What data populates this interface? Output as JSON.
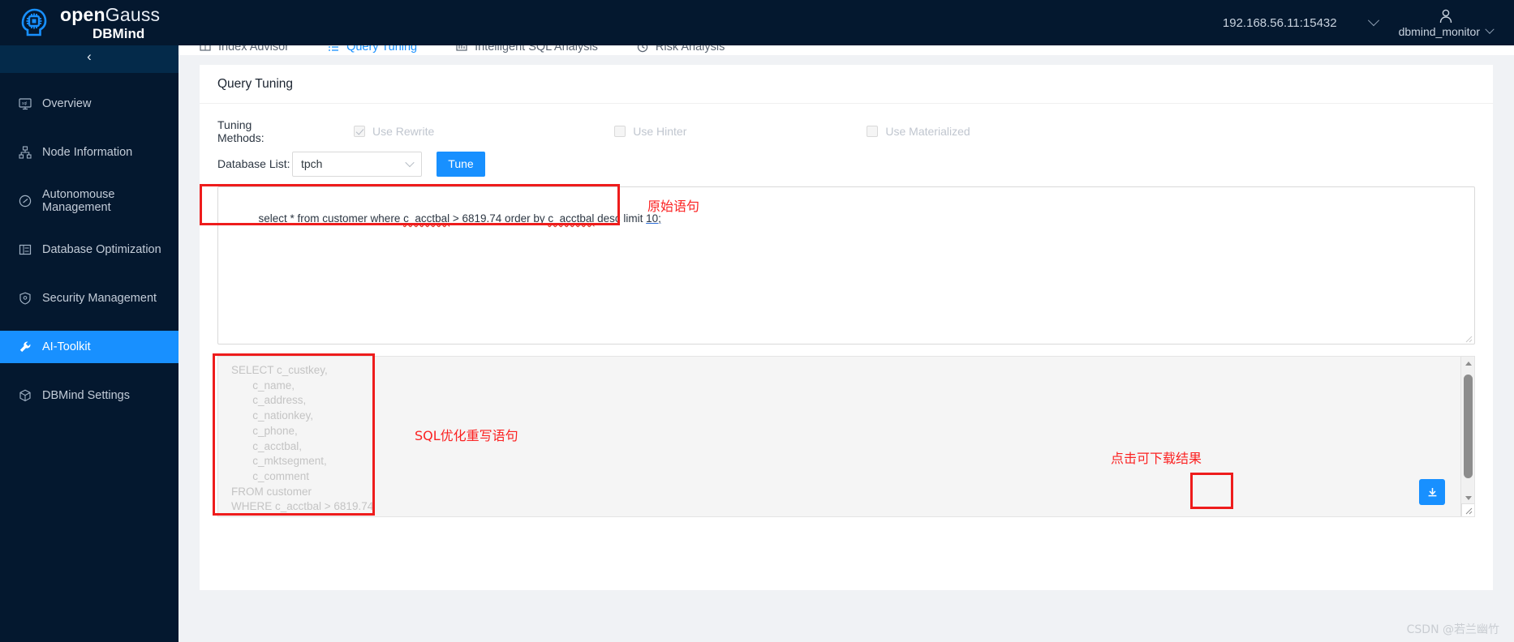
{
  "header": {
    "brand_open": "open",
    "brand_gauss": "Gauss",
    "brand_sub": "DBMind",
    "host": "192.168.56.11:15432",
    "user": "dbmind_monitor"
  },
  "sidebar": {
    "collapse_label": "‹",
    "items": [
      {
        "label": "Overview",
        "icon": "monitor-icon",
        "active": false
      },
      {
        "label": "Node Information",
        "icon": "nodes-icon",
        "active": false
      },
      {
        "label": "Autonomouse Management",
        "icon": "gauge-icon",
        "active": false
      },
      {
        "label": "Database Optimization",
        "icon": "list-icon",
        "active": false
      },
      {
        "label": "Security Management",
        "icon": "shield-icon",
        "active": false
      },
      {
        "label": "AI-Toolkit",
        "icon": "wrench-icon",
        "active": true
      },
      {
        "label": "DBMind Settings",
        "icon": "cube-icon",
        "active": false
      }
    ]
  },
  "tabs": [
    {
      "label": "Index Advisor",
      "icon": "book-icon",
      "active": false
    },
    {
      "label": "Query Tuning",
      "icon": "list-icon",
      "active": true
    },
    {
      "label": "Intelligent SQL Analysis",
      "icon": "chart-icon",
      "active": false
    },
    {
      "label": "Risk Analysis",
      "icon": "clock-icon",
      "active": false
    }
  ],
  "panel": {
    "title": "Query Tuning",
    "tuning_methods_label": "Tuning Methods:",
    "methods": [
      {
        "label": "Use Rewrite",
        "checked": true
      },
      {
        "label": "Use Hinter",
        "checked": false
      },
      {
        "label": "Use Materialized",
        "checked": false
      }
    ],
    "database_list_label": "Database List:",
    "database_value": "tpch",
    "tune_button": "Tune",
    "sql_input": "select * from customer where c_acctbal > 6819.74 order by c_acctbal desc limit 10;",
    "sql_input_parts": {
      "p1": "select * from customer where ",
      "p2": "c_acctbal",
      "p3": " > 6819.74 order by ",
      "p4": "c_acctbal",
      "p5": " desc limit ",
      "p6": "10;"
    },
    "result_sql": "SELECT c_custkey,\n       c_name,\n       c_address,\n       c_nationkey,\n       c_phone,\n       c_acctbal,\n       c_mktsegment,\n       c_comment\nFROM customer\nWHERE c_acctbal > 6819.74"
  },
  "annotations": {
    "original_statement": "原始语句",
    "rewritten_statement": "SQL优化重写语句",
    "download_hint": "点击可下载结果"
  },
  "watermark": "CSDN @若兰幽竹",
  "colors": {
    "brand_dark": "#04182f",
    "accent_blue": "#1890ff",
    "annotation_red": "#ee1c1c"
  }
}
